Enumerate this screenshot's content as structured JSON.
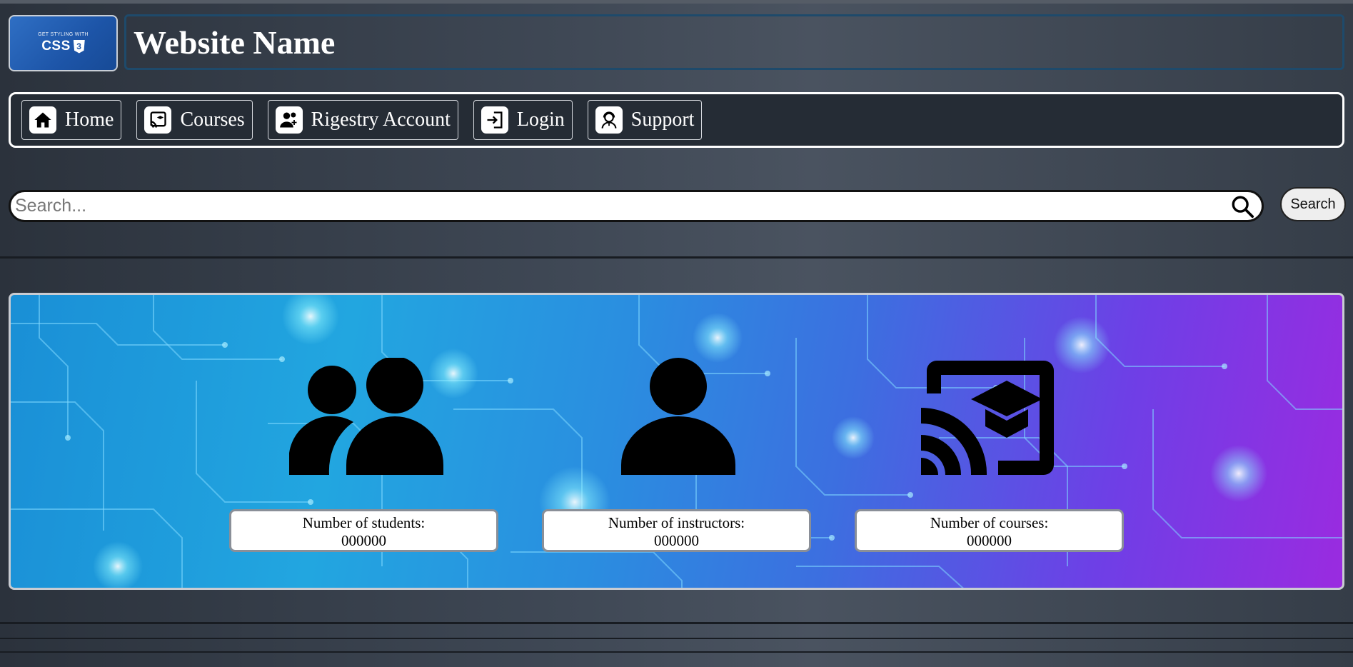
{
  "header": {
    "logo_small": "GET STYLING WITH",
    "logo_big": "CSS",
    "logo_badge": "3",
    "site_title": "Website Name"
  },
  "nav": {
    "items": [
      {
        "label": "Home",
        "icon": "home-icon"
      },
      {
        "label": "Courses",
        "icon": "courses-cast-icon"
      },
      {
        "label": "Rigestry Account",
        "icon": "add-user-icon"
      },
      {
        "label": "Login",
        "icon": "login-icon"
      },
      {
        "label": "Support",
        "icon": "support-agent-icon"
      }
    ]
  },
  "search": {
    "placeholder": "Search...",
    "value": "",
    "button_label": "Search"
  },
  "stats": [
    {
      "label": "Number of students:",
      "value": "000000",
      "icon": "group-icon"
    },
    {
      "label": "Number of instructors:",
      "value": "000000",
      "icon": "person-icon"
    },
    {
      "label": "Number of courses:",
      "value": "000000",
      "icon": "cast-for-education-icon"
    }
  ],
  "colors": {
    "background": "#3e4754",
    "nav_background": "#252c35",
    "title_border": "#1e4a6b",
    "banner_start": "#1a8fd6",
    "banner_end": "#9a2be0"
  }
}
